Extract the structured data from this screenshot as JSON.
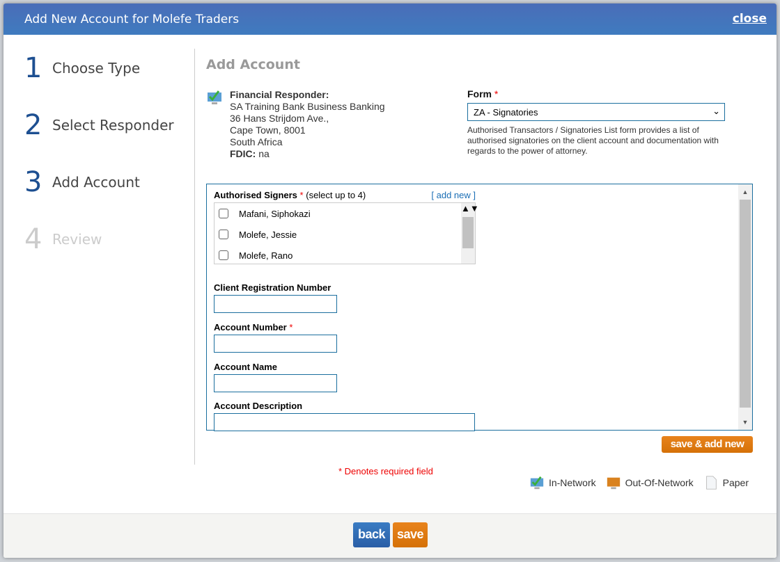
{
  "header": {
    "title": "Add New Account for Molefe Traders",
    "close": "close"
  },
  "steps": [
    {
      "num": "1",
      "label": "Choose Type"
    },
    {
      "num": "2",
      "label": "Select Responder"
    },
    {
      "num": "3",
      "label": "Add Account"
    },
    {
      "num": "4",
      "label": "Review"
    }
  ],
  "main": {
    "title": "Add Account",
    "responder": {
      "label": "Financial Responder:",
      "lines": [
        "SA Training Bank Business Banking",
        "36 Hans Strijdom Ave.,",
        "Cape Town, 8001",
        "South Africa"
      ],
      "fdic_label": "FDIC:",
      "fdic": "na"
    },
    "form": {
      "label": "Form",
      "required": "*",
      "selected": "ZA - Signatories",
      "description": "Authorised Transactors / Signatories List form provides a list of authorised signatories on the client account and documentation with regards to the power of attorney."
    },
    "signers": {
      "label": "Authorised Signers",
      "required": "*",
      "hint": "(select up to 4)",
      "add_new": "[ add new ]",
      "items": [
        "Mafani, Siphokazi",
        "Molefe, Jessie",
        "Molefe, Rano"
      ]
    },
    "fields": {
      "client_reg": "Client Registration Number",
      "account_number": "Account Number",
      "account_name": "Account Name",
      "account_description": "Account Description"
    },
    "save_add_new": "save & add new",
    "required_note": "* Denotes required field",
    "legend": {
      "in_network": "In-Network",
      "out_network": "Out-Of-Network",
      "paper": "Paper"
    }
  },
  "footer": {
    "back": "back",
    "save": "save"
  },
  "colors": {
    "header": "#4171b9",
    "accent": "#e07d14",
    "primary": "#2f6cb5"
  }
}
